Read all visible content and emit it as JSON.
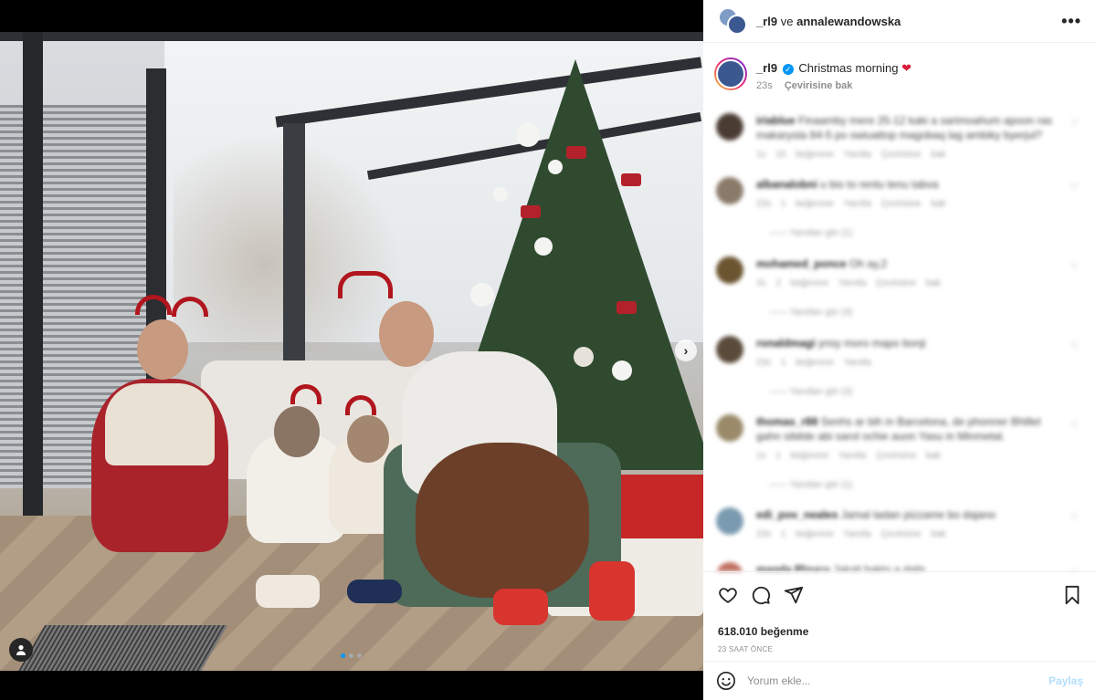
{
  "post": {
    "header": {
      "user1": "_rl9",
      "joiner": "ve",
      "user2": "annalewandowska",
      "more_icon": "more-horizontal-icon"
    },
    "caption": {
      "username": "_rl9",
      "verified_mark": "✓",
      "text": "Christmas morning",
      "emoji": "❤",
      "time": "23s",
      "translate": "Çevirisine bak"
    },
    "carousel": {
      "dots": 3,
      "active_index": 0,
      "next_icon": "›"
    },
    "comments": [
      {
        "user": "iriablue",
        "text": "Finaamby mere 25-12 kaki a sarimoahum apoon ras makarysta 84-5 po swiuattop magobaq lag ambiky byerjul?",
        "meta": "1s  10 beğenme  Yanıtla  Çevirisine bak",
        "replies": ""
      },
      {
        "user": "albanalobni",
        "text": "u bio to rentu tenu tabva",
        "meta": "23s  1 beğenme  Yanıtla  Çevirisine bak",
        "replies": "—— Yanıtları gör (1)"
      },
      {
        "user": "mohamed_ponce",
        "text": "Oh ay,2",
        "meta": "2s  2 beğenme  Yanıtla  Çevirisine bak",
        "replies": "—— Yanıtları gör (3)"
      },
      {
        "user": "ronaldmagi",
        "text": "ynsy moro mapo bonji",
        "meta": "23s  1 beğenme  Yanıtla",
        "replies": "—— Yanıtları gör (3)"
      },
      {
        "user": "thomas_r88",
        "text": "Senhs ar bih in Barcelona, de phonner Bhillet gahn sibilde abi sarol ochie auon Yasu in Minmetal.",
        "meta": "1s  1 beğenme  Yanıtla  Çevirisine bak",
        "replies": "—— Yanıtları gör (1)"
      },
      {
        "user": "edi_pov_neales",
        "text": "Jamal tadan pizzame bo dajano",
        "meta": "23s  1 beğenme  Yanıtla  Çevirisine bak",
        "replies": ""
      },
      {
        "user": "magda.Plzucu",
        "text": "Jakali bakto a dalis",
        "meta": "",
        "replies": ""
      }
    ],
    "actions": {
      "like_icon": "heart-outline-icon",
      "comment_icon": "comment-bubble-icon",
      "share_icon": "paper-plane-icon",
      "save_icon": "bookmark-icon"
    },
    "likes": "618.010 beğenme",
    "time_ago": "23 SAAT ÖNCE",
    "add_comment": {
      "placeholder": "Yorum ekle...",
      "submit_label": "Paylaş",
      "emoji_icon": "smiley-icon"
    }
  },
  "colors": {
    "accent": "#0095f6",
    "submit_disabled": "#b2dffc",
    "meta_text": "#8e8e8e",
    "heart": "#d91e3a"
  }
}
